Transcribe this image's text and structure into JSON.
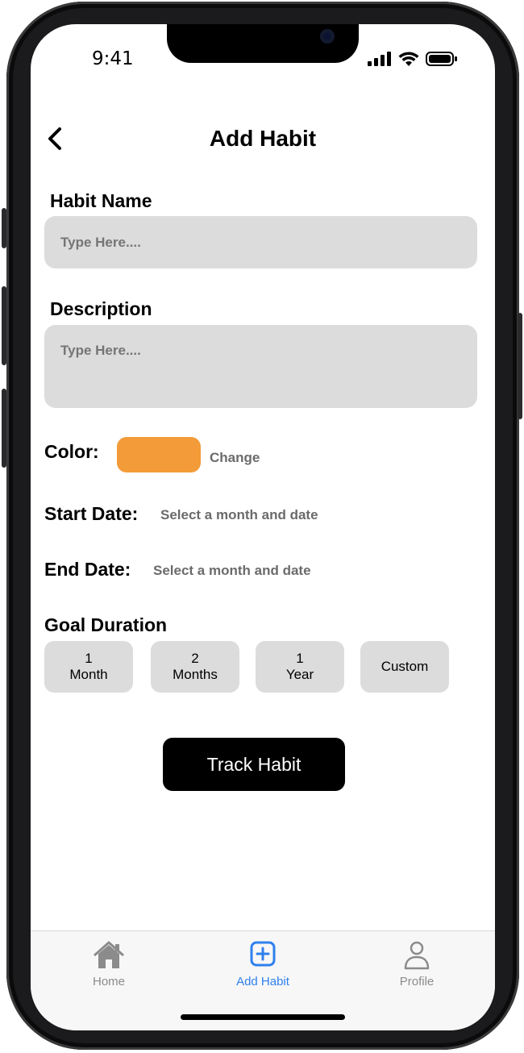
{
  "status_bar": {
    "time": "9:41"
  },
  "header": {
    "title": "Add Habit"
  },
  "form": {
    "habit_name": {
      "label": "Habit Name",
      "placeholder": "Type Here...."
    },
    "description": {
      "label": "Description",
      "placeholder": "Type Here...."
    },
    "color": {
      "label": "Color:",
      "value": "#f29b38",
      "change_label": "Change"
    },
    "start_date": {
      "label": "Start Date:",
      "placeholder": "Select a month and date"
    },
    "end_date": {
      "label": "End Date:",
      "placeholder": "Select a month and date"
    },
    "goal_duration": {
      "label": "Goal Duration",
      "options": [
        {
          "line1": "1",
          "line2": "Month"
        },
        {
          "line1": "2",
          "line2": "Months"
        },
        {
          "line1": "1",
          "line2": "Year"
        },
        {
          "line1": "",
          "line2": "Custom"
        }
      ]
    },
    "submit_label": "Track Habit"
  },
  "tab_bar": {
    "items": [
      {
        "label": "Home",
        "icon": "home-icon",
        "active": false
      },
      {
        "label": "Add Habit",
        "icon": "plus-square-icon",
        "active": true
      },
      {
        "label": "Profile",
        "icon": "person-icon",
        "active": false
      }
    ]
  },
  "colors": {
    "accent": "#2f80ed",
    "swatch": "#f29b38",
    "field_bg": "#dcdcdc"
  }
}
